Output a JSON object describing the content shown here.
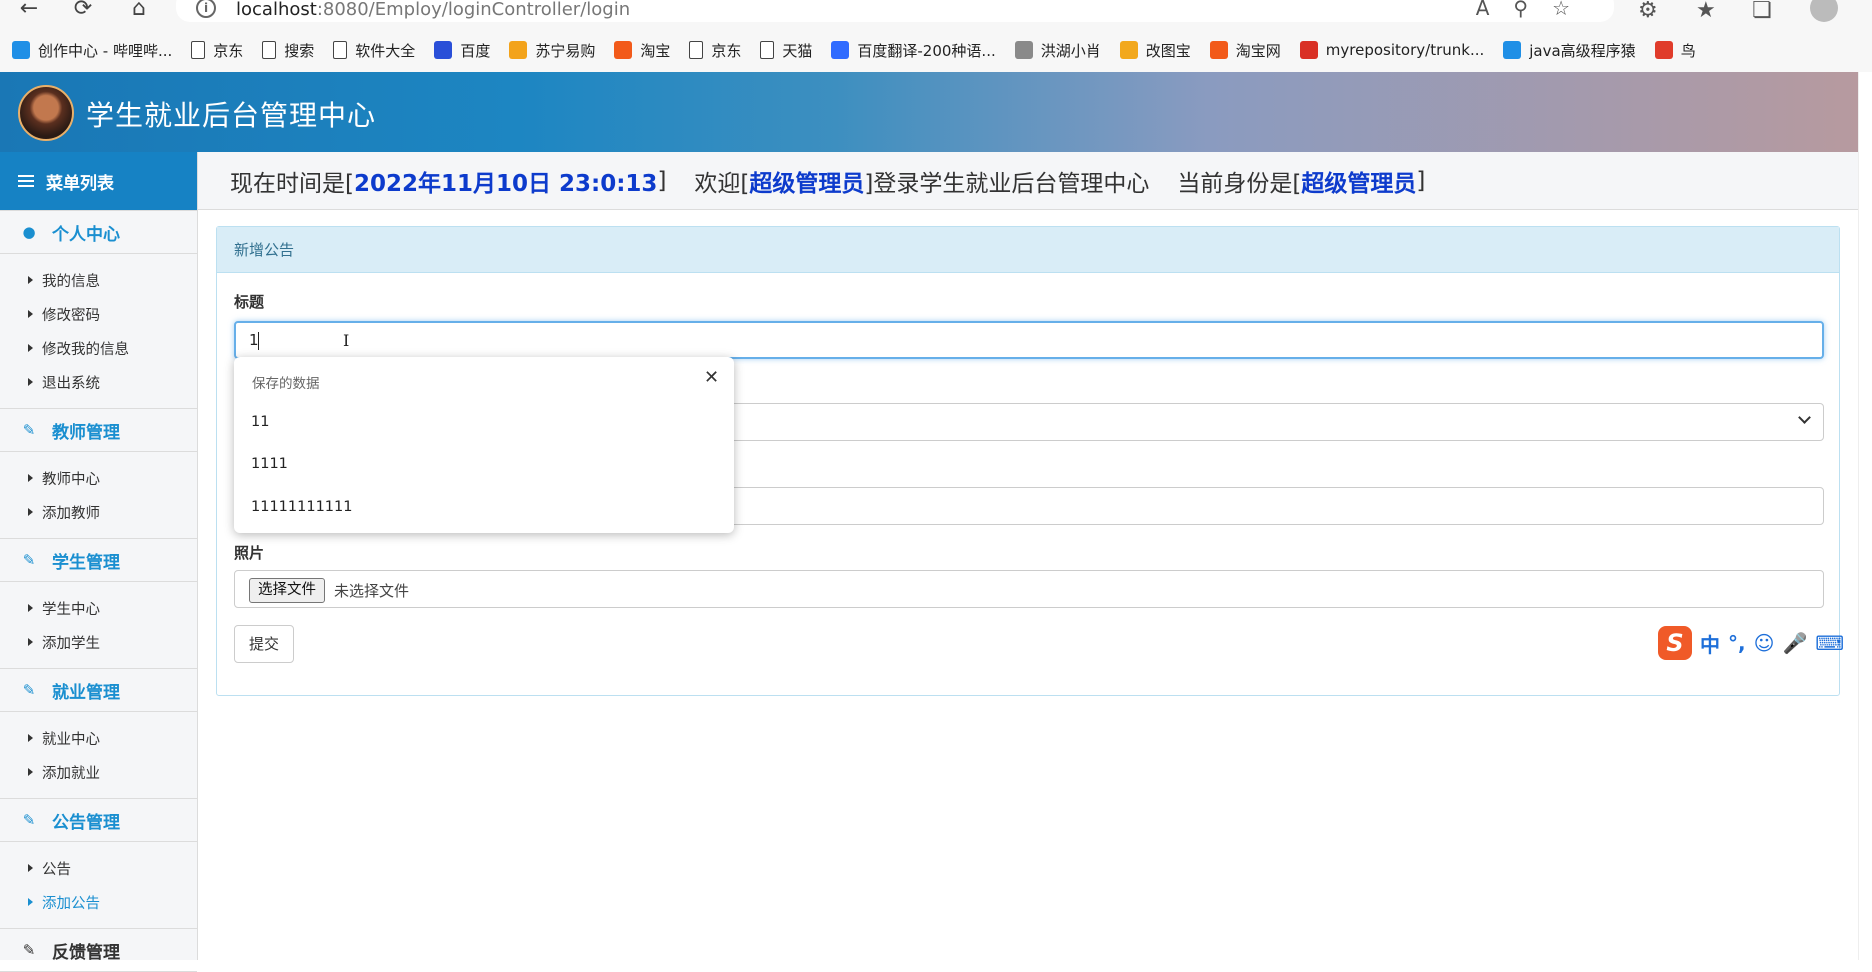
{
  "browser": {
    "url_host": "localhost",
    "url_path": ":8080/Employ/loginController/login",
    "bookmarks": [
      {
        "label": "创作中心 - 哔哩哔...",
        "icon": "bilibili-icon",
        "color": "#1f8fe6"
      },
      {
        "label": "京东",
        "icon": "page-icon",
        "color": ""
      },
      {
        "label": "搜索",
        "icon": "page-icon",
        "color": ""
      },
      {
        "label": "软件大全",
        "icon": "page-icon",
        "color": ""
      },
      {
        "label": "百度",
        "icon": "baidu-icon",
        "color": "#2a4fd8"
      },
      {
        "label": "苏宁易购",
        "icon": "suning-icon",
        "color": "#f3a31b"
      },
      {
        "label": "淘宝",
        "icon": "taobao-icon",
        "color": "#f25a1a"
      },
      {
        "label": "京东",
        "icon": "page-icon",
        "color": ""
      },
      {
        "label": "天猫",
        "icon": "page-icon",
        "color": ""
      },
      {
        "label": "百度翻译-200种语...",
        "icon": "translate-icon",
        "color": "#2f6bff"
      },
      {
        "label": "洪湖小肖",
        "icon": "bird-icon",
        "color": "#8a8a8a"
      },
      {
        "label": "改图宝",
        "icon": "gaitubao-icon",
        "color": "#f2a81d"
      },
      {
        "label": "淘宝网",
        "icon": "taobao-icon",
        "color": "#f25a1a"
      },
      {
        "label": "myrepository/trunk...",
        "icon": "chrome-icon",
        "color": "#d93025"
      },
      {
        "label": "java高级程序猿",
        "icon": "bilibili-icon",
        "color": "#1f8fe6"
      },
      {
        "label": "鸟",
        "icon": "bird-icon",
        "color": "#e03c2b"
      }
    ]
  },
  "header": {
    "title": "学生就业后台管理中心"
  },
  "sidebar": {
    "title": "菜单列表",
    "groups": [
      {
        "label": "个人中心",
        "icon": "user-icon",
        "items": [
          "我的信息",
          "修改密码",
          "修改我的信息",
          "退出系统"
        ]
      },
      {
        "label": "教师管理",
        "icon": "edit-icon",
        "items": [
          "教师中心",
          "添加教师"
        ]
      },
      {
        "label": "学生管理",
        "icon": "edit-icon",
        "items": [
          "学生中心",
          "添加学生"
        ]
      },
      {
        "label": "就业管理",
        "icon": "edit-icon",
        "items": [
          "就业中心",
          "添加就业"
        ]
      },
      {
        "label": "公告管理",
        "icon": "edit-icon",
        "items": [
          "公告",
          "添加公告"
        ]
      },
      {
        "label": "反馈管理",
        "icon": "edit-icon",
        "items": []
      }
    ]
  },
  "status": {
    "time_prefix": "现在时间是[",
    "time_value": "2022年11月10日 23:0:13",
    "time_suffix": "]",
    "welcome_prefix": "欢迎[",
    "welcome_user": "超级管理员",
    "welcome_suffix": "]登录学生就业后台管理中心",
    "role_prefix": "当前身份是[",
    "role_value": "超级管理员",
    "role_suffix": "]"
  },
  "panel": {
    "heading": "新增公告",
    "title_label": "标题",
    "title_value": "1",
    "photo_label": "照片",
    "file_button": "选择文件",
    "file_hint": "未选择文件",
    "submit": "提交"
  },
  "autofill": {
    "heading": "保存的数据",
    "items": [
      "11",
      "1111",
      "11111111111"
    ]
  },
  "ime": {
    "logo": "S",
    "mode": "中"
  }
}
